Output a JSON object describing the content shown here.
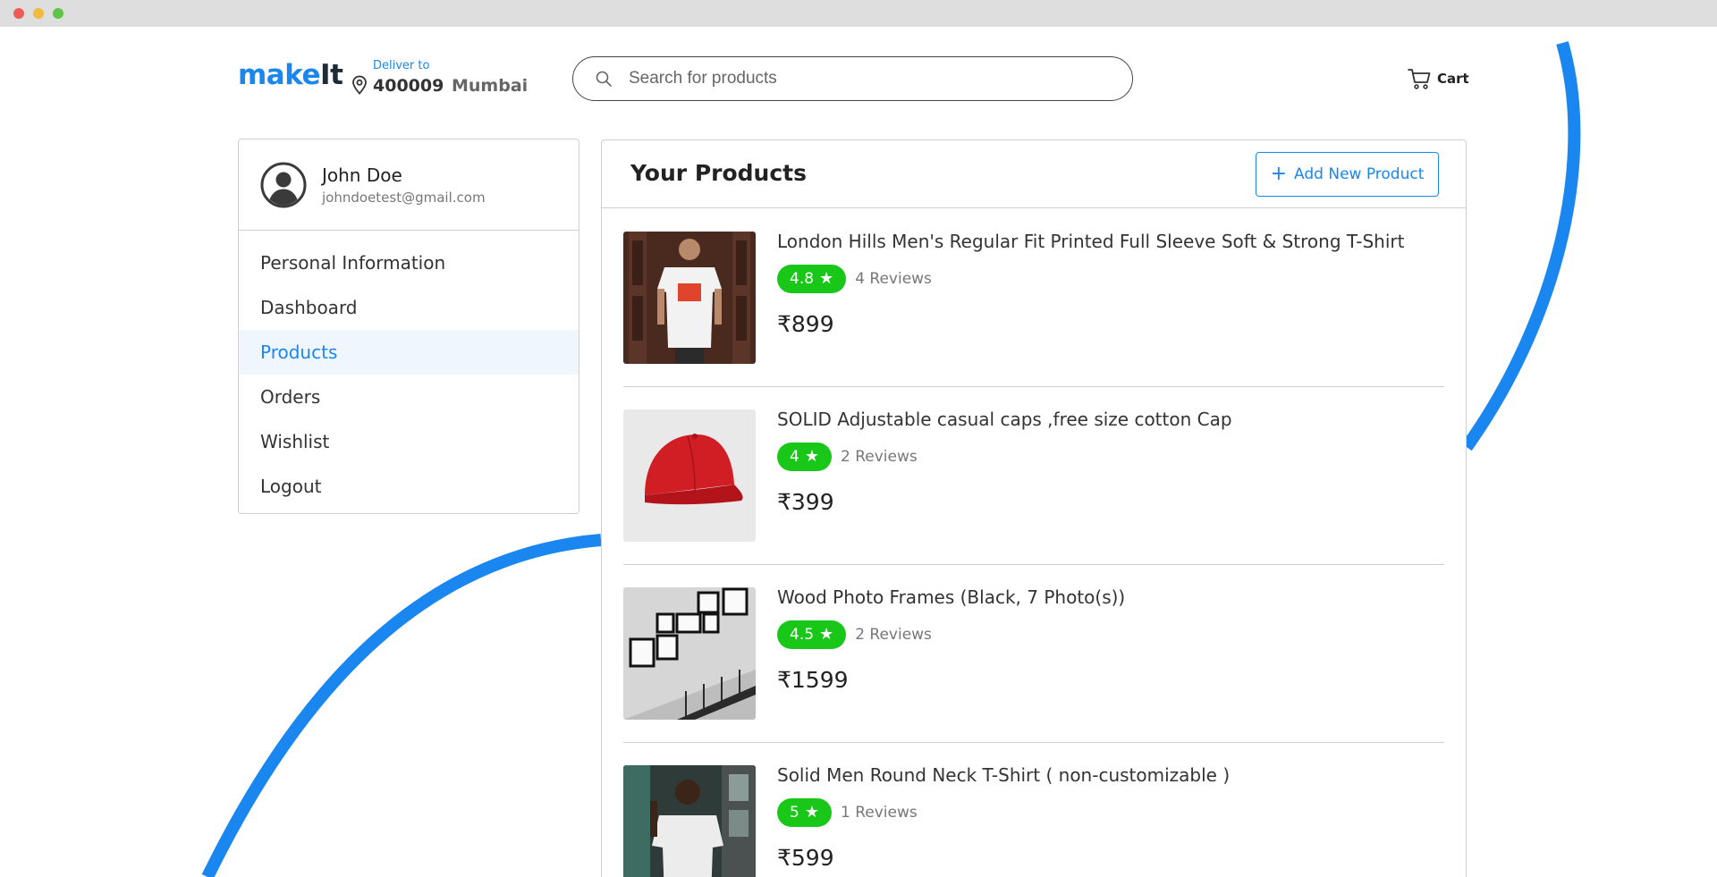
{
  "brand": {
    "part1": "make",
    "part2": "It",
    "color": "#1a86f0"
  },
  "delivery": {
    "label": "Deliver to",
    "pincode": "400009",
    "city": "Mumbai"
  },
  "search": {
    "placeholder": "Search for products",
    "value": ""
  },
  "cart": {
    "label": "Cart"
  },
  "user": {
    "name": "John Doe",
    "email": "johndoetest@gmail.com"
  },
  "sidebar": {
    "items": [
      {
        "label": "Personal Information",
        "active": false
      },
      {
        "label": "Dashboard",
        "active": false
      },
      {
        "label": "Products",
        "active": true
      },
      {
        "label": "Orders",
        "active": false
      },
      {
        "label": "Wishlist",
        "active": false
      },
      {
        "label": "Logout",
        "active": false
      }
    ]
  },
  "products_panel": {
    "title": "Your Products",
    "add_button": "Add New Product",
    "items": [
      {
        "title": "London Hills Men's Regular Fit Printed Full Sleeve Soft & Strong T-Shirt",
        "rating": "4.8",
        "reviews": "4 Reviews",
        "price": "₹899",
        "image": "man-in-white-tshirt"
      },
      {
        "title": "SOLID Adjustable casual caps ,free size cotton Cap",
        "rating": "4",
        "reviews": "2 Reviews",
        "price": "₹399",
        "image": "red-cap"
      },
      {
        "title": "Wood Photo Frames (Black, 7 Photo(s))",
        "rating": "4.5",
        "reviews": "2 Reviews",
        "price": "₹1599",
        "image": "photo-frames-on-wall"
      },
      {
        "title": "Solid Men Round Neck T-Shirt ( non-customizable )",
        "rating": "5",
        "reviews": "1 Reviews",
        "price": "₹599",
        "image": "man-in-grey-tshirt"
      }
    ]
  },
  "colors": {
    "accent": "#1a86f0",
    "rating": "#19c719",
    "active_bg": "#eff6fe"
  },
  "star_glyph": "★"
}
